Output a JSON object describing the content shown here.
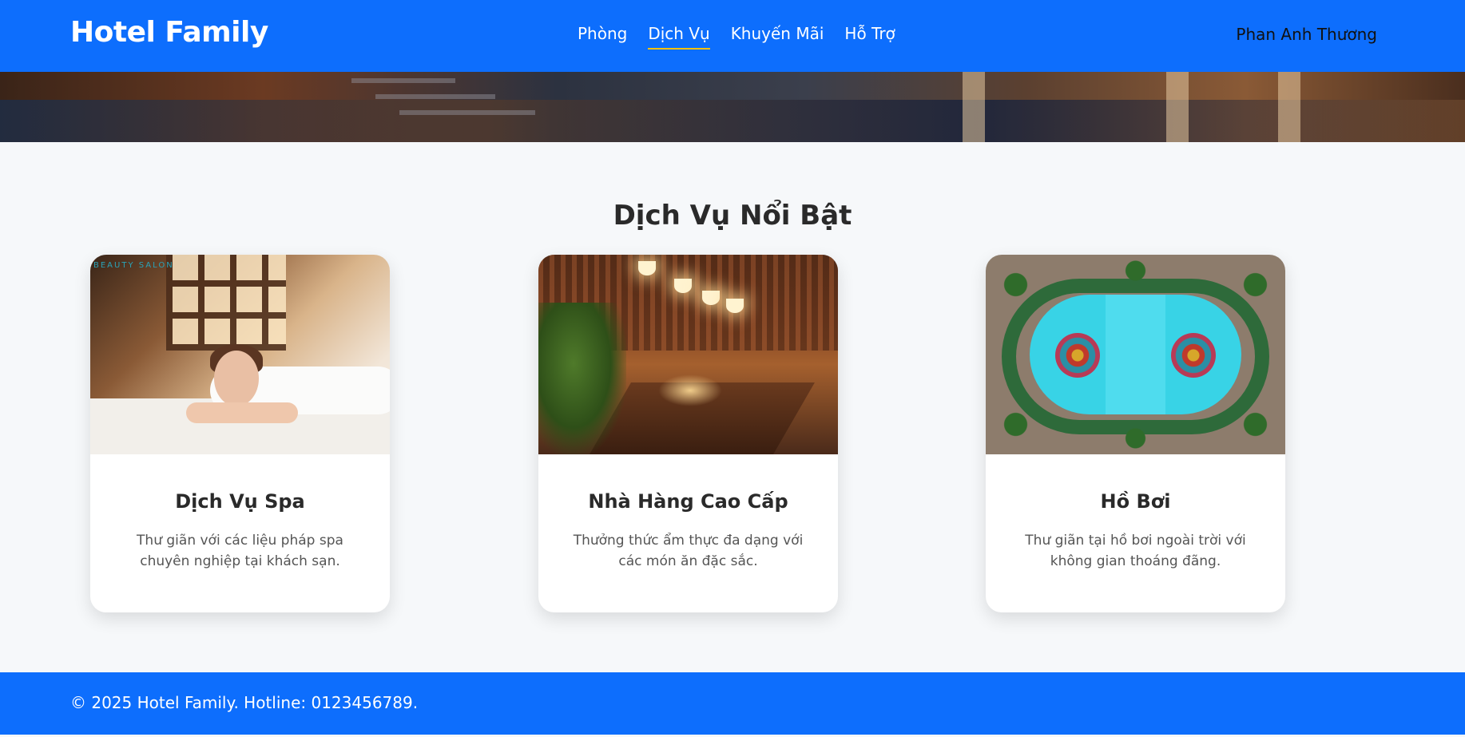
{
  "header": {
    "brand": "Hotel Family",
    "nav": [
      "Phòng",
      "Dịch Vụ",
      "Khuyến Mãi",
      "Hỗ Trợ"
    ],
    "active_nav": "Dịch Vụ",
    "user_name": "Phan Anh Thương"
  },
  "section": {
    "title": "Dịch Vụ Nổi Bật"
  },
  "cards": [
    {
      "title": "Dịch Vụ Spa",
      "description": "Thư giãn với các liệu pháp spa chuyên nghiệp tại khách sạn.",
      "image_logo_text": "BEAUTY SALON"
    },
    {
      "title": "Nhà Hàng Cao Cấp",
      "description": "Thưởng thức ẩm thực đa dạng với các món ăn đặc sắc."
    },
    {
      "title": "Hồ Bơi",
      "description": "Thư giãn tại hồ bơi ngoài trời với không gian thoáng đãng."
    }
  ],
  "footer": {
    "text": "© 2025 Hotel Family. Hotline: 0123456789."
  },
  "colors": {
    "primary": "#0d6efd",
    "active_underline": "#ffc107",
    "page_bg": "#f6f8fa"
  }
}
